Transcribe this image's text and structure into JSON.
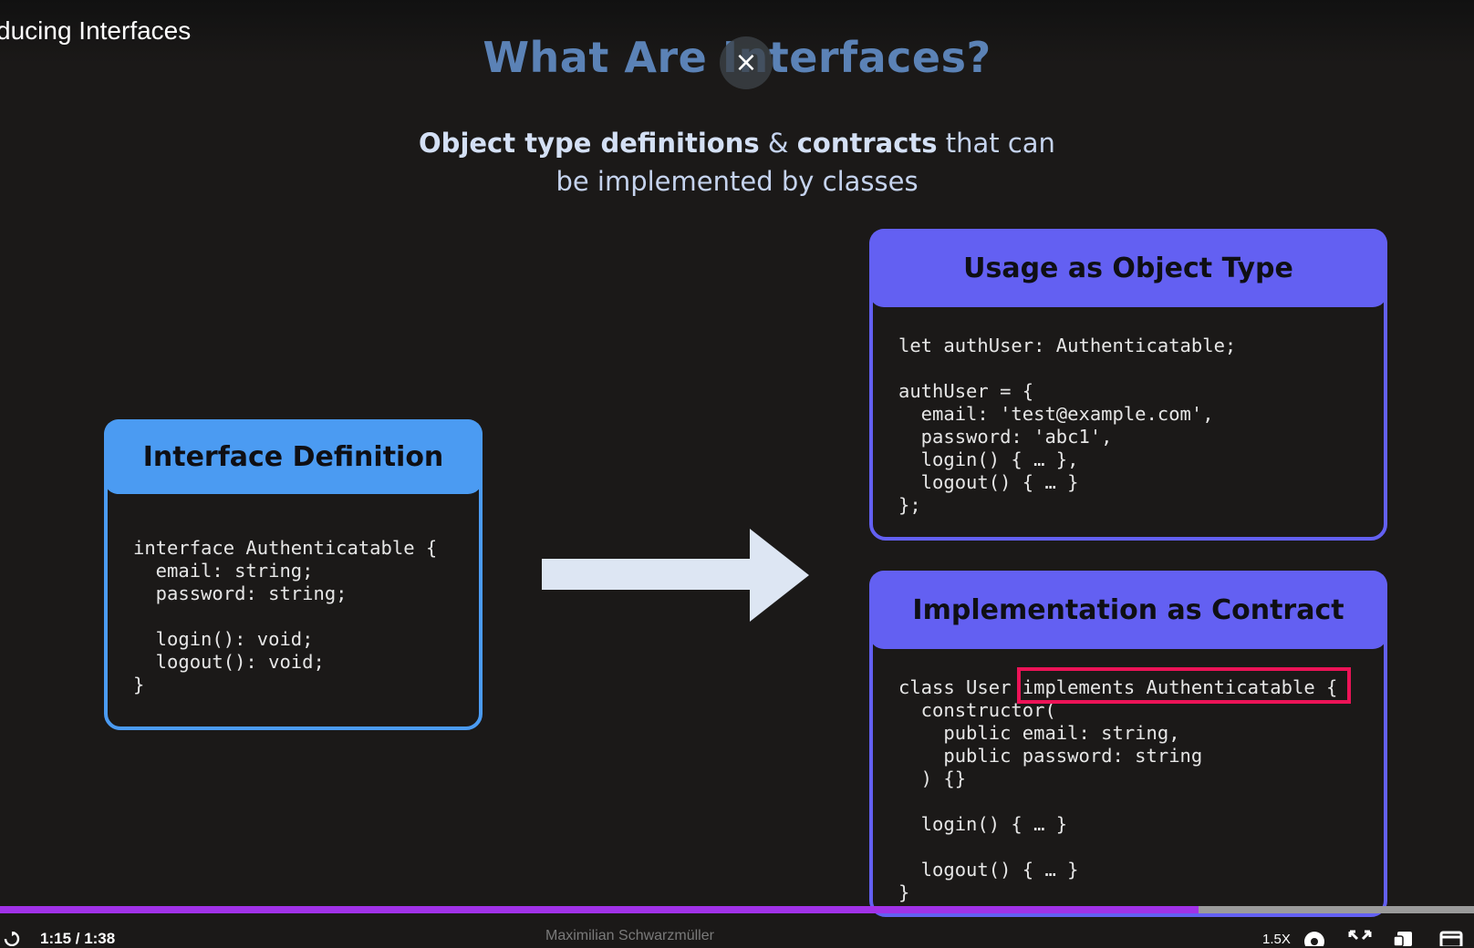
{
  "video": {
    "title": "ducing Interfaces",
    "close_label": "×"
  },
  "slide": {
    "title": "What Are Interfaces?",
    "subtitle": {
      "part1_bold": "Object type definitions",
      "amp": " & ",
      "part2_bold": "contracts",
      "part3": " that can",
      "line2": "be implemented by classes"
    },
    "cards": {
      "definition": {
        "title": "Interface Definition",
        "code": "interface Authenticatable {\n  email: string;\n  password: string;\n\n  login(): void;\n  logout(): void;\n}"
      },
      "usage": {
        "title": "Usage as Object Type",
        "code": "let authUser: Authenticatable;\n\nauthUser = {\n  email: 'test@example.com',\n  password: 'abc1',\n  login() { … },\n  logout() { … }\n};"
      },
      "implementation": {
        "title": "Implementation as Contract",
        "code": "class User implements Authenticatable {\n  constructor(\n    public email: string,\n    public password: string\n  ) {}\n\n  login() { … }\n\n  logout() { … }\n}"
      }
    },
    "colors": {
      "title": "#5b82b6",
      "definition_accent": "#4b9bf2",
      "card_accent": "#6360f2",
      "highlight": "#ec1357",
      "arrow": "#dde6f3"
    }
  },
  "player": {
    "time": "1:15 / 1:38",
    "progress": 0.813,
    "author": "Maximilian Schwarzmüller",
    "speed": "1.5X",
    "progress_color": "#a132e8"
  }
}
